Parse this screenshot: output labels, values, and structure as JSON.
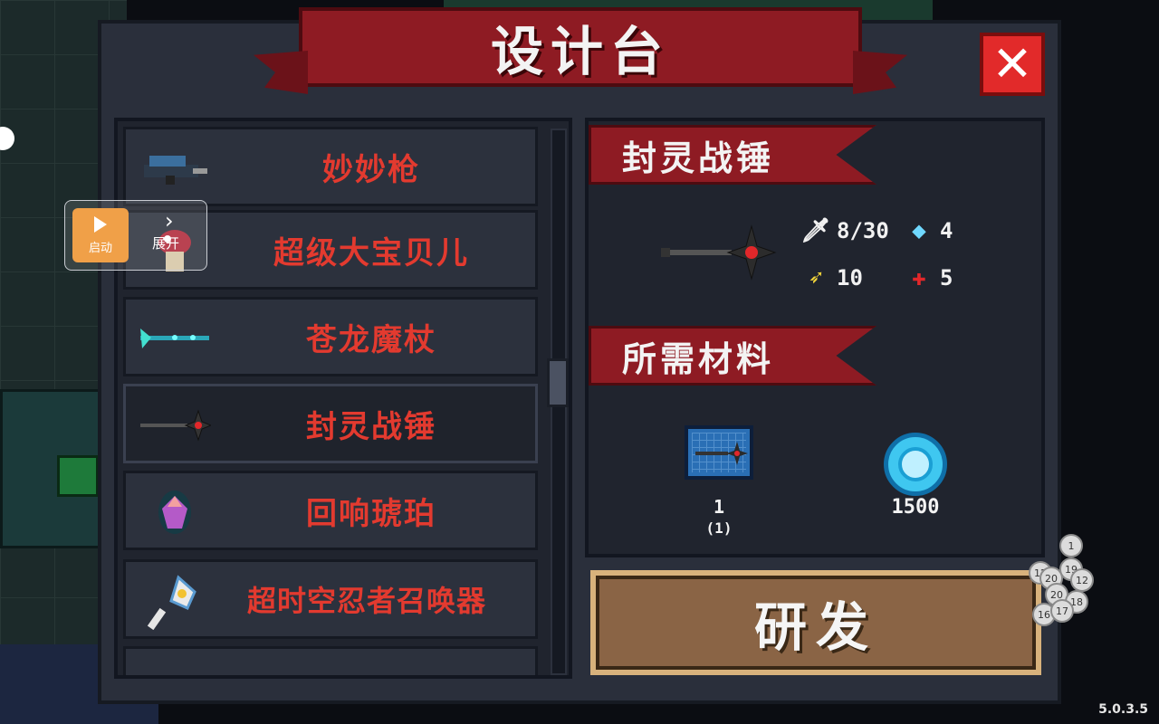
{
  "title": "设计台",
  "close_label": "✕",
  "list": {
    "items": [
      {
        "label": "妙妙枪",
        "icon": "gun-icon"
      },
      {
        "label": "超级大宝贝儿",
        "icon": "mushroom-icon"
      },
      {
        "label": "苍龙魔杖",
        "icon": "staff-icon"
      },
      {
        "label": "封灵战锤",
        "icon": "hammer-icon",
        "selected": true
      },
      {
        "label": "回响琥珀",
        "icon": "amber-icon"
      },
      {
        "label": "超时空忍者召唤器",
        "icon": "summoner-icon"
      }
    ]
  },
  "detail": {
    "item_name": "封灵战锤",
    "stats": {
      "attack": "8/30",
      "energy": "4",
      "speed": "10",
      "crit": "5"
    },
    "materials_title": "所需材料",
    "materials": [
      {
        "name": "blueprint",
        "count": "1",
        "sub": "(1)"
      },
      {
        "name": "gem",
        "count": "1500"
      }
    ]
  },
  "research_label": "研发",
  "overlay": {
    "start_label": "启动",
    "expand_label": "展开"
  },
  "bubbles": [
    "1",
    "12",
    "20",
    "19",
    "12",
    "20",
    "18",
    "16",
    "17"
  ],
  "version": "5.0.3.5",
  "colors": {
    "banner_red": "#8e1b23",
    "list_text_red": "#e33a2f",
    "close_red": "#e22a2a",
    "research_brown": "#8a6445"
  }
}
